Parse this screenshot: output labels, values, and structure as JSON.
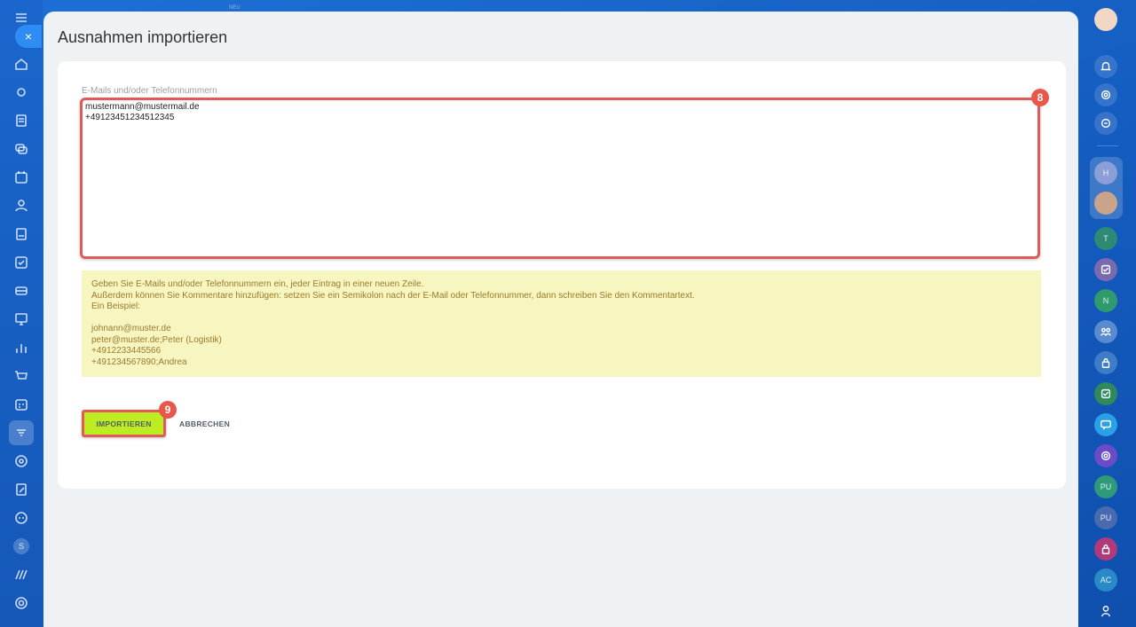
{
  "top_label": "NEU",
  "panel": {
    "title": "Ausnahmen importieren",
    "field_label": "E-Mails und/oder Telefonnummern",
    "textarea_value": "mustermann@mustermail.de\n+49123451234512345",
    "hint_lines": [
      "Geben Sie E-Mails und/oder Telefonnummern ein, jeder Eintrag in einer neuen Zeile.",
      "Außerdem können Sie Kommentare hinzufügen: setzen Sie ein Semikolon nach der E-Mail oder Telefonnummer, dann schreiben Sie den Kommentartext.",
      "Ein Beispiel:"
    ],
    "example_lines": [
      "johnann@muster.de",
      "peter@muster.de;Peter (Logistik)",
      "+4912233445566",
      "+491234567890;Andrea"
    ],
    "import_label": "IMPORTIEREN",
    "cancel_label": "ABBRECHEN",
    "marker_textarea": "8",
    "marker_button": "9"
  },
  "close_label": "×",
  "right_bar": {
    "avatars": [
      "H",
      "T",
      "N",
      "PU",
      "PU",
      "AC"
    ]
  },
  "left_bar": {
    "badge": "S"
  },
  "colors": {
    "accent_green": "#bbed21",
    "highlight_red": "#e05a5a",
    "hint_bg": "#f8f6c0",
    "hint_text": "#9a7a2a"
  }
}
